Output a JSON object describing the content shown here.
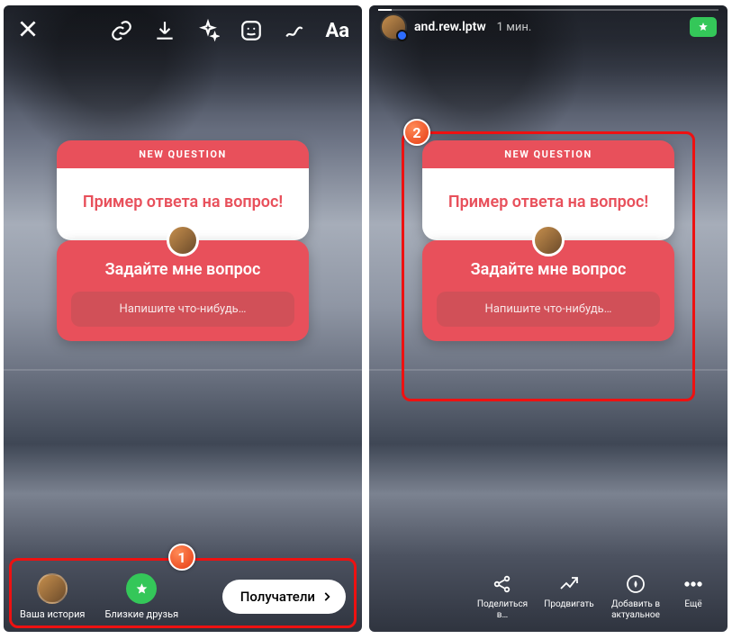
{
  "icons": {
    "close": "close-icon",
    "link": "link-icon",
    "download": "download-icon",
    "sparkle": "sparkle-icon",
    "sticker": "sticker-icon",
    "draw": "draw-icon",
    "text": "Aa",
    "star": "star-icon",
    "chevron_right": "chevron-right-icon",
    "share": "share-icon",
    "promote": "promote-icon",
    "highlight": "highlight-icon",
    "more": "more-icon"
  },
  "colors": {
    "accent": "#e8505b",
    "close_friends": "#34c759",
    "annotation": "#e11"
  },
  "left_screen": {
    "question_card": {
      "header_label": "NEW QUESTION",
      "answer_text": "Пример ответа на вопрос!",
      "prompt_text": "Задайте мне вопрос",
      "input_placeholder": "Напишите что-нибудь…"
    },
    "bottom": {
      "your_story_label": "Ваша история",
      "close_friends_label": "Близкие друзья",
      "recipients_button": "Получатели"
    },
    "annotation_number": "1"
  },
  "right_screen": {
    "header": {
      "username": "and.rew.lptw",
      "timestamp": "1 мин."
    },
    "question_card": {
      "header_label": "NEW QUESTION",
      "answer_text": "Пример ответа на вопрос!",
      "prompt_text": "Задайте мне вопрос",
      "input_placeholder": "Напишите что-нибудь…"
    },
    "bottom": {
      "share_label": "Поделиться\nв…",
      "promote_label": "Продвигать",
      "highlight_label": "Добавить в\nактуальное",
      "more_label": "Ещё"
    },
    "annotation_number": "2"
  }
}
